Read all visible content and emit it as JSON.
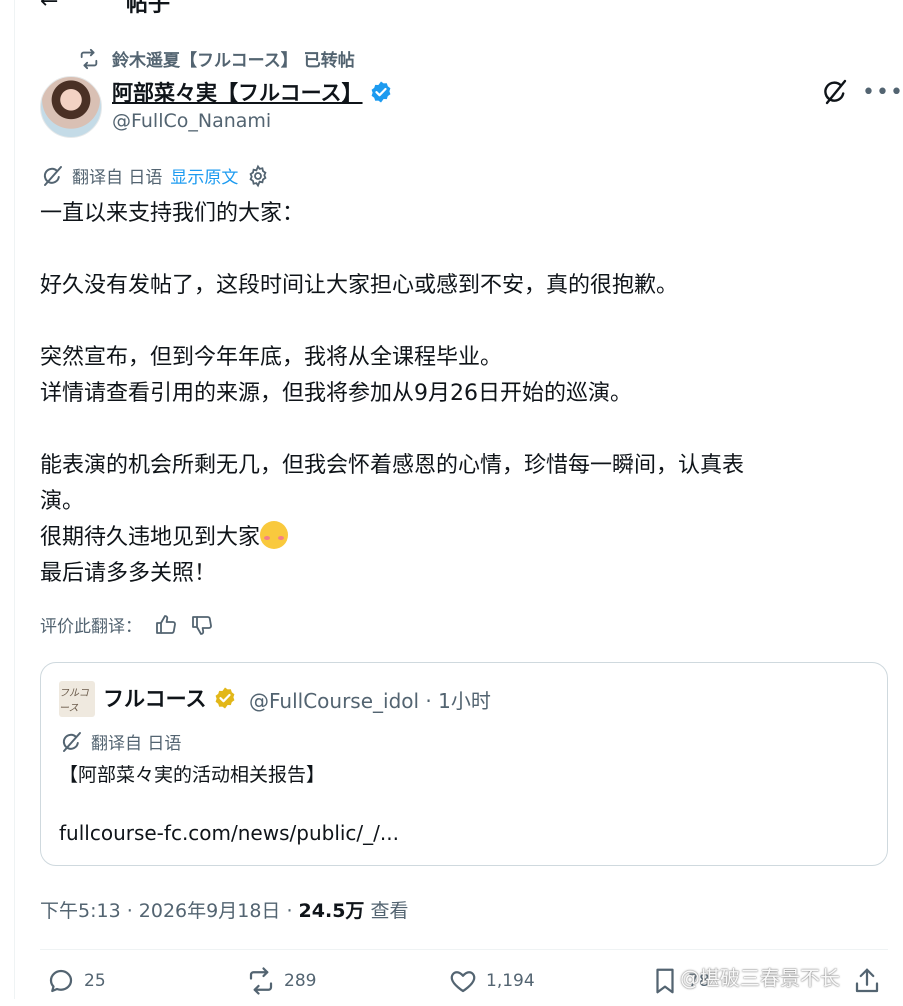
{
  "header": {
    "back_icon": "arrow-left-icon",
    "title": "帖子"
  },
  "repost": {
    "text": "鈴木遥夏【フルコース】 已转帖",
    "icon": "repost-icon"
  },
  "author": {
    "name": "阿部菜々実【フルコース】",
    "handle": "@FullCo_Nanami",
    "verified_color": "#1d9bf0"
  },
  "translation": {
    "label": "翻译自 日语",
    "show_original": "显示原文",
    "settings_icon": "gear-icon"
  },
  "tweet": {
    "lines": [
      "一直以来支持我们的大家：",
      "",
      "好久没有发帖了，这段时间让大家担心或感到不安，真的很抱歉。",
      "",
      "突然宣布，但到今年年底，我将从全课程毕业。",
      "详情请查看引用的来源，但我将参加从9月26日开始的巡演。",
      "",
      "能表演的机会所剩无几，但我会怀着感恩的心情，珍惜每一瞬间，认真表",
      "演。",
      "很期待久违地见到大家",
      "最后请多多关照！"
    ],
    "emoji": "smiling-face-emoji"
  },
  "rate": {
    "label": "评价此翻译："
  },
  "quote": {
    "avatar_text": "フルコース",
    "name": "フルコース",
    "handle_time": "@FullCourse_idol · 1小时",
    "translation_label": "翻译自 日语",
    "text": "【阿部菜々実的活动相关报告】",
    "link": "fullcourse-fc.com/news/public/_/...",
    "verified_color": "#e2b719"
  },
  "meta": {
    "time_date": "下午5:13 · 2026年9月18日 · ",
    "views": "24.5万",
    "views_label": " 查看"
  },
  "actions": {
    "replies": "25",
    "reposts": "289",
    "likes": "1,194",
    "bookmarks": "78"
  },
  "watermark": "@堪破三春景不长"
}
